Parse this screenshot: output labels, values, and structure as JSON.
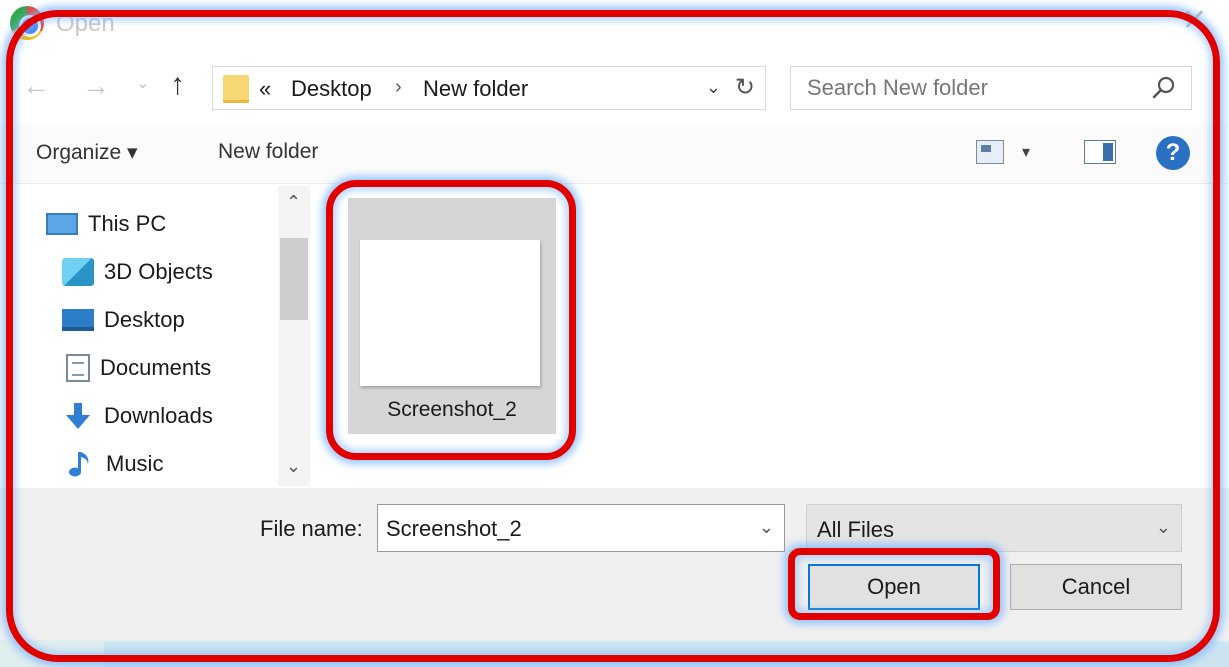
{
  "titlebar": {
    "title": "Open",
    "close_glyph": "✕",
    "app_icon": "chrome-icon"
  },
  "navigation": {
    "back_glyph": "←",
    "forward_glyph": "→",
    "recent_glyph": "⌄",
    "up_glyph": "↑",
    "breadcrumb": {
      "overflow": "«",
      "items": [
        "Desktop",
        "New folder"
      ],
      "separator": "›"
    },
    "address_dropdown_glyph": "⌄",
    "refresh_glyph": "↻",
    "search_placeholder": "Search New folder"
  },
  "toolbar": {
    "organize_label": "Organize ▾",
    "new_folder_label": "New folder",
    "view_dropdown_glyph": "▾",
    "help_glyph": "?"
  },
  "sidebar": {
    "items": [
      {
        "label": "This PC",
        "icon": "computer-icon"
      },
      {
        "label": "3D Objects",
        "icon": "cube-icon"
      },
      {
        "label": "Desktop",
        "icon": "desktop-icon"
      },
      {
        "label": "Documents",
        "icon": "document-icon"
      },
      {
        "label": "Downloads",
        "icon": "download-arrow-icon"
      },
      {
        "label": "Music",
        "icon": "music-note-icon"
      }
    ],
    "scroll_up_glyph": "⌃",
    "scroll_down_glyph": "⌄"
  },
  "files": [
    {
      "name": "Screenshot_2",
      "selected": true
    }
  ],
  "bottom": {
    "file_name_label": "File name:",
    "file_name_value": "Screenshot_2",
    "file_name_dropdown_glyph": "⌄",
    "file_type_value": "All Files",
    "file_type_dropdown_glyph": "⌄",
    "open_label": "Open",
    "cancel_label": "Cancel"
  },
  "colors": {
    "highlight": "#e00000",
    "accent": "#0078d7",
    "selection": "#d6d6d6",
    "help": "#2a71c4"
  }
}
